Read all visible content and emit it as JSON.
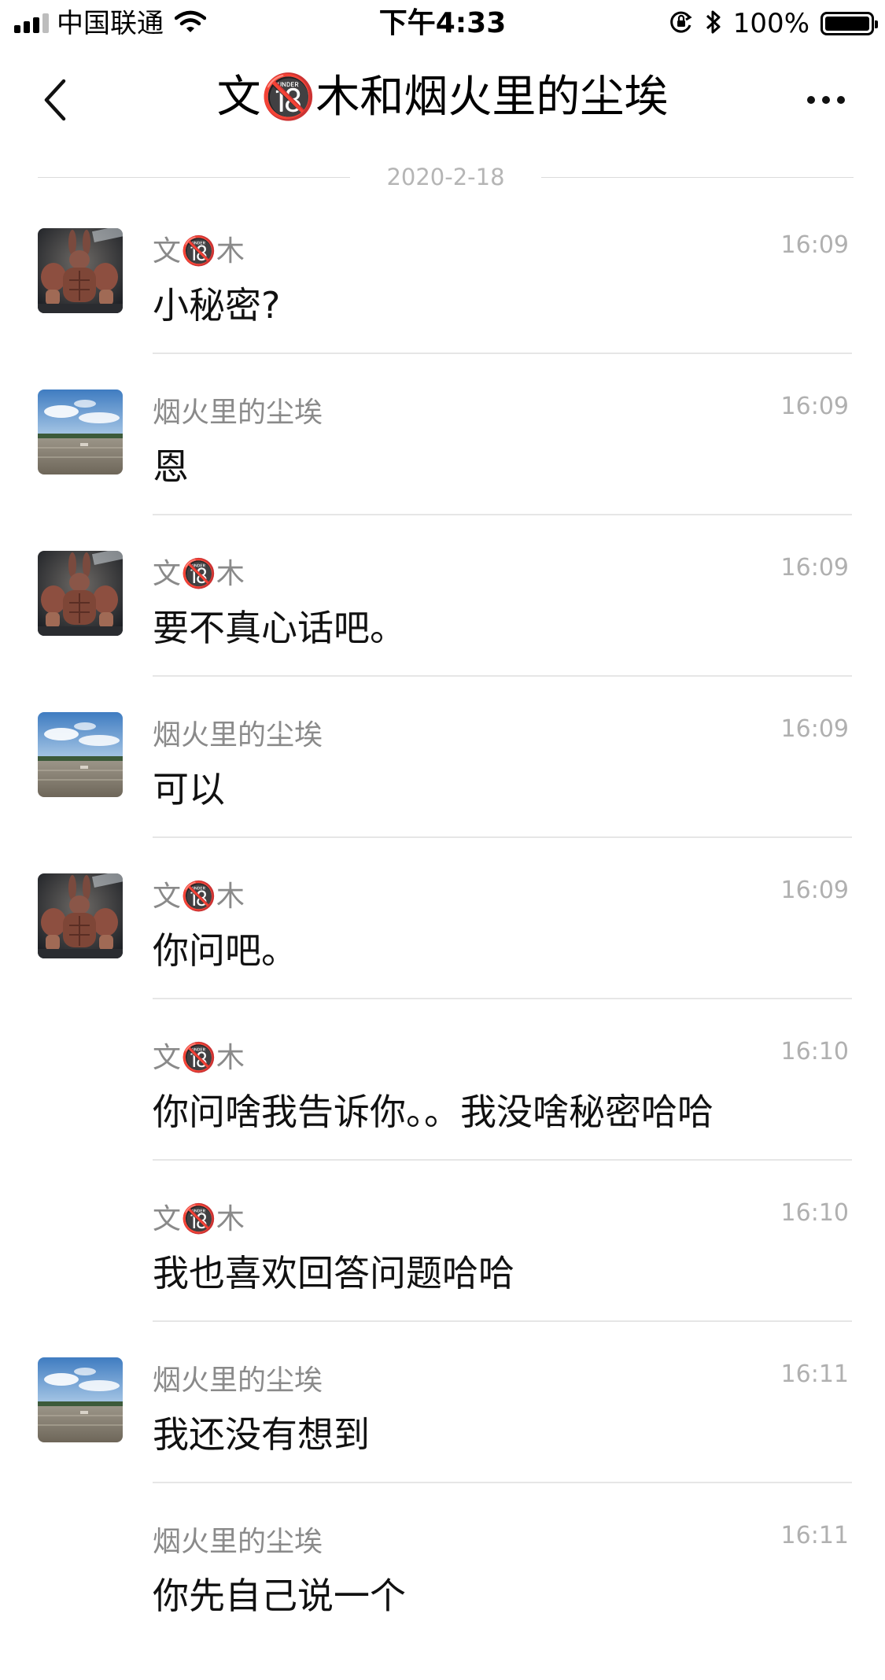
{
  "status_bar": {
    "carrier": "中国联通",
    "time": "下午4:33",
    "battery_percent": "100%"
  },
  "nav": {
    "title": "文🔞木和烟火里的尘埃"
  },
  "date_divider": "2020-2-18",
  "messages": [
    {
      "sender": "文🔞木",
      "time": "16:09",
      "text": "小秘密?",
      "avatar": "bunny"
    },
    {
      "sender": "烟火里的尘埃",
      "time": "16:09",
      "text": "恩",
      "avatar": "landscape"
    },
    {
      "sender": "文🔞木",
      "time": "16:09",
      "text": "要不真心话吧。",
      "avatar": "bunny"
    },
    {
      "sender": "烟火里的尘埃",
      "time": "16:09",
      "text": "可以",
      "avatar": "landscape"
    },
    {
      "sender": "文🔞木",
      "time": "16:09",
      "text": "你问吧。",
      "avatar": "bunny"
    },
    {
      "sender": "文🔞木",
      "time": "16:10",
      "text": "你问啥我告诉你。。我没啥秘密哈哈",
      "avatar": ""
    },
    {
      "sender": "文🔞木",
      "time": "16:10",
      "text": "我也喜欢回答问题哈哈",
      "avatar": ""
    },
    {
      "sender": "烟火里的尘埃",
      "time": "16:11",
      "text": "我还没有想到",
      "avatar": "landscape"
    },
    {
      "sender": "烟火里的尘埃",
      "time": "16:11",
      "text": "你先自己说一个",
      "avatar": ""
    }
  ]
}
